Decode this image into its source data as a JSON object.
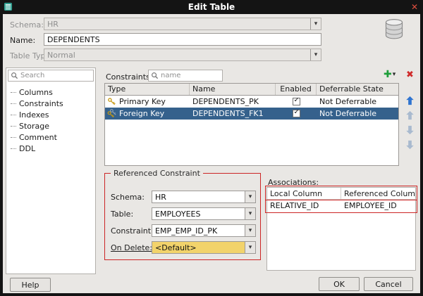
{
  "window": {
    "title": "Edit Table"
  },
  "icons": {
    "close": "✕",
    "add": "✚",
    "caret": "▾",
    "delete": "✖"
  },
  "header_form": {
    "schema": {
      "label": "Schema:",
      "value": "HR"
    },
    "name": {
      "label": "Name:",
      "value": "DEPENDENTS"
    },
    "table_type": {
      "label": "Table Type:",
      "value": "Normal"
    }
  },
  "sidebar": {
    "search_placeholder": "Search",
    "items": [
      {
        "label": "Columns"
      },
      {
        "label": "Constraints"
      },
      {
        "label": "Indexes"
      },
      {
        "label": "Storage"
      },
      {
        "label": "Comment"
      },
      {
        "label": "DDL"
      }
    ]
  },
  "constraints_panel": {
    "label": "Constraints:",
    "filter_placeholder": "name",
    "columns": {
      "type": "Type",
      "name": "Name",
      "enabled": "Enabled",
      "deferrable": "Deferrable State"
    },
    "rows": [
      {
        "type": "Primary Key",
        "name": "DEPENDENTS_PK",
        "enabled": true,
        "deferrable": "Not Deferrable"
      },
      {
        "type": "Foreign Key",
        "name": "DEPENDENTS_FK1",
        "enabled": true,
        "deferrable": "Not Deferrable"
      }
    ]
  },
  "referenced_constraint": {
    "title": "Referenced Constraint",
    "schema": {
      "label": "Schema:",
      "value": "HR"
    },
    "table": {
      "label": "Table:",
      "value": "EMPLOYEES"
    },
    "constraint": {
      "label": "Constraint:",
      "value": "EMP_EMP_ID_PK"
    },
    "on_delete": {
      "label": "On Delete:",
      "value": "<Default>"
    }
  },
  "associations": {
    "label": "Associations:",
    "columns": {
      "local": "Local Column",
      "referenced": "Referenced Column"
    },
    "rows": [
      {
        "local": "RELATIVE_ID",
        "referenced": "EMPLOYEE_ID"
      }
    ]
  },
  "footer": {
    "help": "Help",
    "ok": "OK",
    "cancel": "Cancel"
  },
  "colors": {
    "selection": "#35618c",
    "annotation": "#cc2525",
    "add_green": "#1e9e3a",
    "delete_red": "#cf2b2b",
    "arrow_active": "#2f74d0",
    "arrow_inactive": "#a9bacf",
    "on_delete_highlight": "#f2d36b",
    "titlebar": "#141414"
  }
}
